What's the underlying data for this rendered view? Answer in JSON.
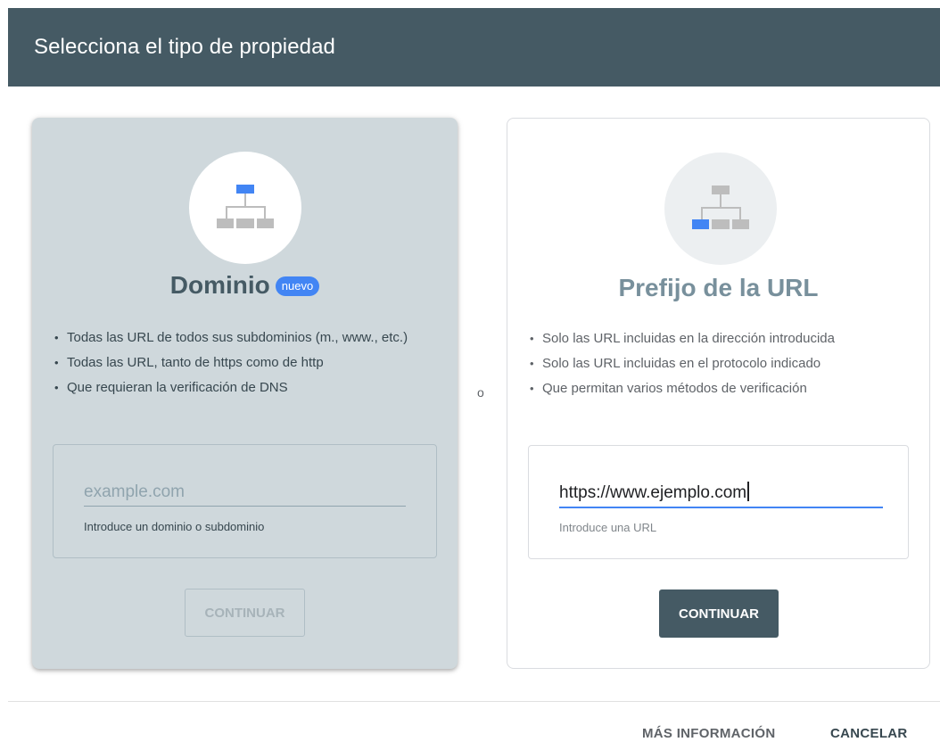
{
  "header": {
    "title": "Selecciona el tipo de propiedad"
  },
  "domain": {
    "title": "Dominio",
    "badge": "nuevo",
    "bullets": [
      "Todas las URL de todos sus subdominios (m., www., etc.)",
      "Todas las URL, tanto de https como de http",
      "Que requieran la verificación de DNS"
    ],
    "input": {
      "placeholder": "example.com",
      "value": "",
      "helper": "Introduce un dominio o subdominio"
    },
    "continue_label": "CONTINUAR",
    "icon": "sitemap-root-icon",
    "colors": {
      "card_bg": "#cfd8dc",
      "highlight": "#4285f4"
    }
  },
  "separator": "o",
  "url_prefix": {
    "title": "Prefijo de la URL",
    "bullets": [
      "Solo las URL incluidas en la dirección introducida",
      "Solo las URL incluidas en el protocolo indicado",
      "Que permitan varios métodos de verificación"
    ],
    "input": {
      "placeholder": "",
      "value": "https://www.ejemplo.com",
      "helper": "Introduce una URL"
    },
    "continue_label": "CONTINUAR",
    "icon": "sitemap-branch-icon",
    "colors": {
      "button_bg": "#455a64",
      "focus_underline": "#4285f4"
    }
  },
  "footer": {
    "more_info_label": "MÁS INFORMACIÓN",
    "cancel_label": "CANCELAR"
  },
  "colors": {
    "header_bg": "#455a64"
  }
}
